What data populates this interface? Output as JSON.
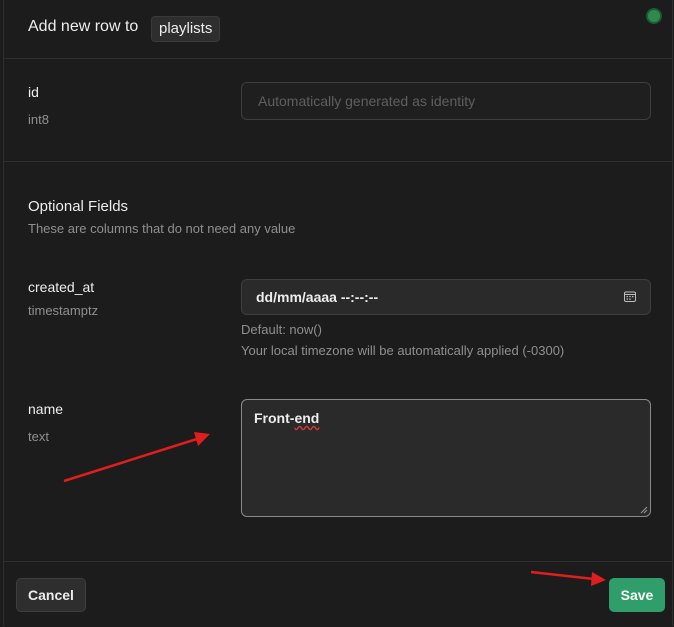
{
  "header": {
    "title": "Add new row to",
    "table_name": "playlists"
  },
  "fields": {
    "id": {
      "label": "id",
      "type": "int8",
      "placeholder": "Automatically generated as identity"
    },
    "optional": {
      "title": "Optional Fields",
      "description": "These are columns that do not need any value"
    },
    "created_at": {
      "label": "created_at",
      "type": "timestamptz",
      "value": "dd/mm/aaaa --:--:--",
      "default_text": "Default: now()",
      "timezone_text": "Your local timezone will be automatically applied (-0300)"
    },
    "name": {
      "label": "name",
      "type": "text",
      "value_prefix": "Front-",
      "value_misspelled": "end"
    }
  },
  "footer": {
    "cancel_label": "Cancel",
    "save_label": "Save"
  },
  "colors": {
    "accent": "#2f9e6a",
    "annotation_arrow": "#e01e1e",
    "status_dot": "#2f8a4f"
  },
  "icons": {
    "status": "status-dot-icon",
    "calendar": "calendar-icon",
    "resize": "resize-grip-icon"
  }
}
